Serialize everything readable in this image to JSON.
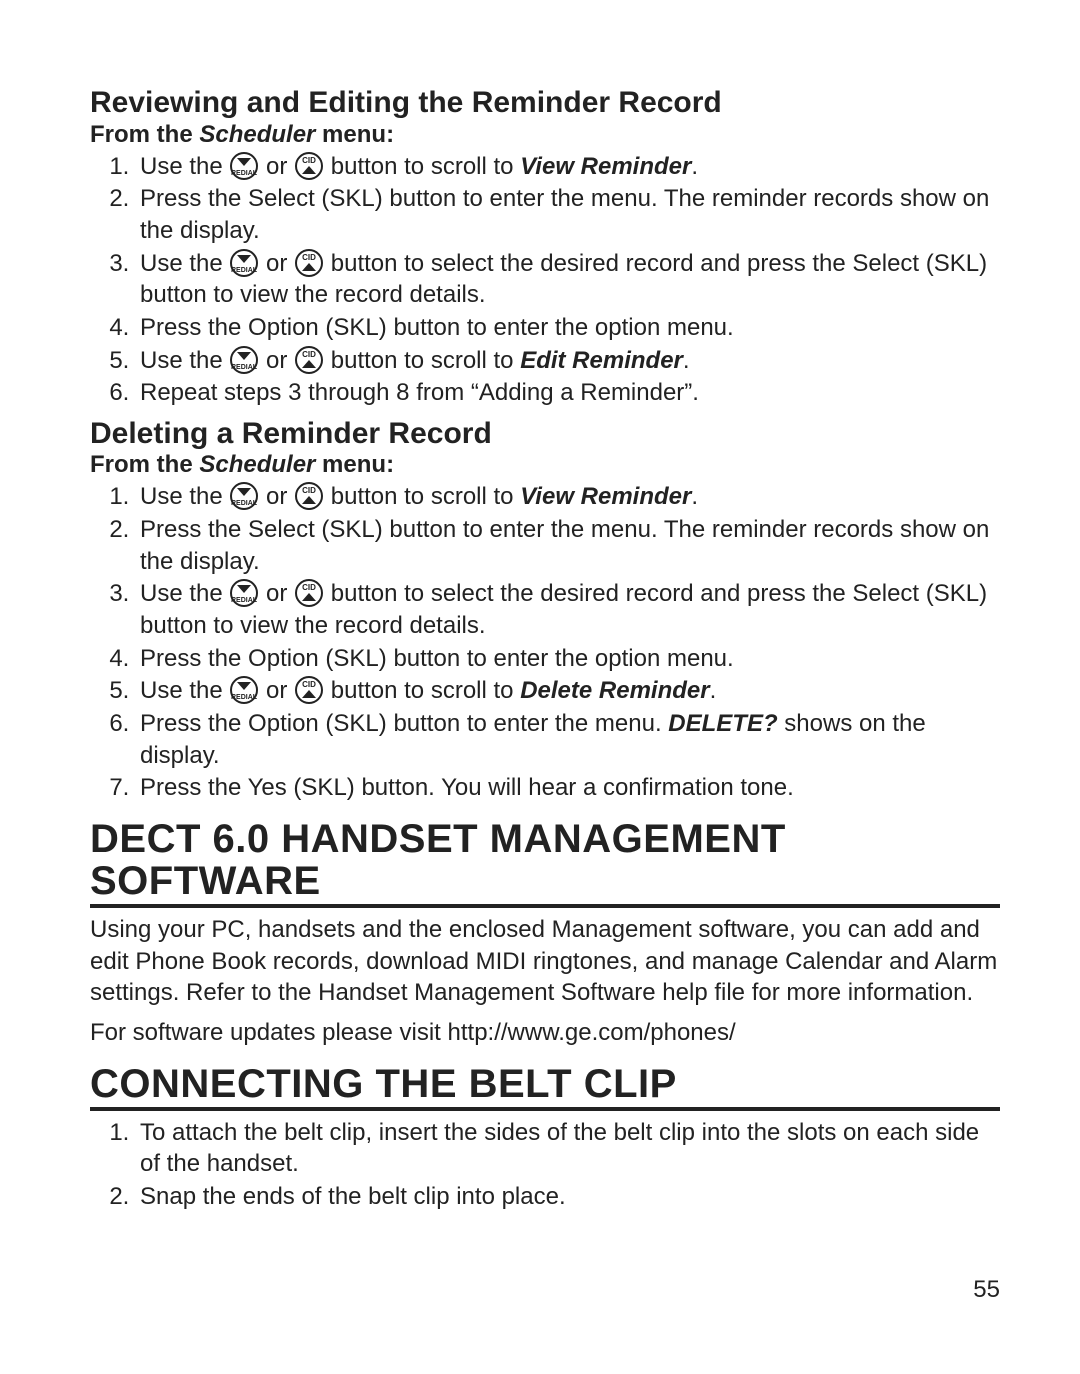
{
  "section1": {
    "heading": "Reviewing and Editing the Reminder Record",
    "from_prefix": "From the ",
    "from_menu": "Scheduler",
    "from_suffix": " menu:",
    "steps": {
      "s1": {
        "pre": "Use the ",
        "mid": " or ",
        "post": " button to scroll to ",
        "target": "View Reminder",
        "end": "."
      },
      "s2": "Press the Select (SKL) button to enter the menu. The reminder records show on the display.",
      "s3": {
        "pre": "Use the ",
        "mid": " or ",
        "post": " button to select the desired record and press the Select (SKL) button to view the record details."
      },
      "s4": "Press the Option (SKL) button to enter the option menu.",
      "s5": {
        "pre": "Use the ",
        "mid": " or ",
        "post": " button to scroll to ",
        "target": "Edit Reminder",
        "end": "."
      },
      "s6": "Repeat steps 3 through 8 from “Adding a Reminder”."
    }
  },
  "section2": {
    "heading": "Deleting a Reminder Record",
    "from_prefix": "From the ",
    "from_menu": "Scheduler",
    "from_suffix": " menu:",
    "steps": {
      "s1": {
        "pre": "Use the ",
        "mid": " or ",
        "post": " button to scroll to ",
        "target": "View Reminder",
        "end": "."
      },
      "s2": "Press the Select (SKL) button to enter the menu. The reminder records show on the display.",
      "s3": {
        "pre": "Use the ",
        "mid": " or ",
        "post": " button to select the desired record and press the Select (SKL) button to view the record details."
      },
      "s4": "Press the Option (SKL) button to enter the option menu.",
      "s5": {
        "pre": "Use the ",
        "mid": " or ",
        "post": " button to scroll to ",
        "target": "Delete Reminder",
        "end": "."
      },
      "s6": {
        "pre": "Press the Option (SKL) button to enter the menu. ",
        "strong": "DELETE?",
        "post": " shows on the display."
      },
      "s7": "Press the Yes (SKL) button. You will hear a confirmation tone."
    }
  },
  "section3": {
    "heading": "DECT 6.0 HANDSET MANAGEMENT SOFTWARE",
    "para1": "Using your PC, handsets and the enclosed Management software, you can add and edit Phone Book records, download MIDI ringtones, and manage Calendar and Alarm settings. Refer to the Handset Management Software help file for more information.",
    "para2": "For software updates please visit http://www.ge.com/phones/"
  },
  "section4": {
    "heading": "CONNECTING THE BELT CLIP",
    "steps": {
      "s1": "To attach the belt clip, insert the sides of the belt clip into the slots on each side of the handset.",
      "s2": "Snap the ends of the belt clip into place."
    }
  },
  "page_number": "55",
  "icons": {
    "down": "redial-down-icon",
    "up": "cid-up-icon"
  }
}
